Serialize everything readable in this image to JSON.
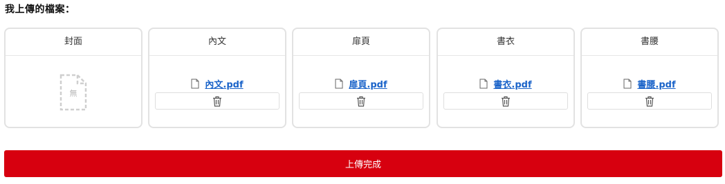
{
  "section_title": "我上傳的檔案：",
  "cards": [
    {
      "header": "封面",
      "placeholder_label": "無"
    },
    {
      "header": "內文",
      "file_name": "內文.pdf"
    },
    {
      "header": "扉頁",
      "file_name": "扉頁.pdf"
    },
    {
      "header": "書衣",
      "file_name": "書衣.pdf"
    },
    {
      "header": "書腰",
      "file_name": "書腰.pdf"
    }
  ],
  "icons": {
    "file": "file-icon",
    "delete": "trash-icon",
    "empty": "empty-file-icon"
  },
  "submit_label": "上傳完成",
  "colors": {
    "accent": "#d7000f",
    "link": "#1a63c9",
    "border": "#e2e2e2"
  }
}
